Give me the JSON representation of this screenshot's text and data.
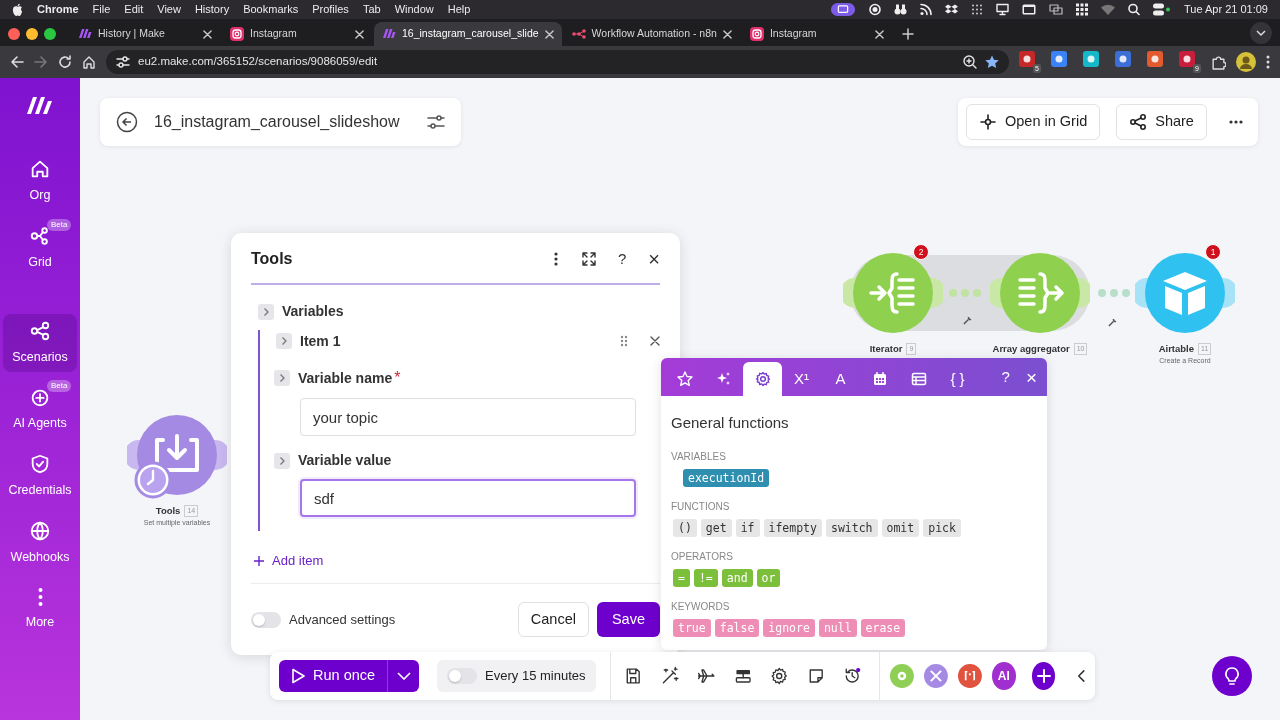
{
  "menubar": {
    "app": "Chrome",
    "items": [
      "File",
      "Edit",
      "View",
      "History",
      "Bookmarks",
      "Profiles",
      "Tab",
      "Window",
      "Help"
    ],
    "clock": "Tue Apr 21 01:09"
  },
  "tabs": [
    {
      "title": "History | Make",
      "selected": false
    },
    {
      "title": "Instagram",
      "selected": false
    },
    {
      "title": "16_instagram_carousel_slide",
      "selected": true
    },
    {
      "title": "Workflow Automation - n8n",
      "selected": false
    },
    {
      "title": "Instagram",
      "selected": false
    }
  ],
  "address": "eu2.make.com/365152/scenarios/9086059/edit",
  "extensions": [
    {
      "kind": "badged",
      "count": "5"
    },
    {
      "kind": "plain"
    },
    {
      "kind": "plain"
    },
    {
      "kind": "plain"
    },
    {
      "kind": "plain"
    },
    {
      "kind": "badged",
      "count": "9"
    }
  ],
  "sidebar": {
    "items": [
      {
        "label": "Org",
        "selected": false
      },
      {
        "label": "Grid",
        "badge": "Beta",
        "selected": false
      },
      {
        "label": "Scenarios",
        "selected": true
      },
      {
        "label": "AI Agents",
        "badge": "Beta",
        "selected": false
      },
      {
        "label": "Credentials",
        "selected": false
      },
      {
        "label": "Webhooks",
        "selected": false
      },
      {
        "label": "More",
        "selected": false
      }
    ]
  },
  "scenario": {
    "name": "16_instagram_carousel_slideshow",
    "actions": [
      "Open in Grid",
      "Share"
    ]
  },
  "nodes": [
    {
      "kind": "tools",
      "name": "Tools",
      "number": "14",
      "subtitle": "Set multiple variables"
    },
    {
      "kind": "iterator",
      "name": "Iterator",
      "number": "9",
      "badge": "2"
    },
    {
      "kind": "aggregator",
      "name": "Array aggregator",
      "number": "10"
    },
    {
      "kind": "airtable",
      "name": "Airtable",
      "number": "11",
      "subtitle": "Create a Record",
      "badge": "1"
    }
  ],
  "dialog": {
    "title": "Tools",
    "help": "?",
    "close": "×",
    "section": "Variables",
    "item": "Item 1",
    "required_mark": "*",
    "fields": [
      {
        "label": "Variable name",
        "required": true,
        "value": "your topic",
        "focused": false
      },
      {
        "label": "Variable value",
        "required": false,
        "value": "sdf",
        "focused": true
      }
    ],
    "add_item": "Add item",
    "advanced": {
      "label": "Advanced settings",
      "on": false
    },
    "cancel": "Cancel",
    "save": "Save"
  },
  "functions": {
    "tabs": [
      {
        "kind": "icon",
        "selected": false
      },
      {
        "kind": "icon",
        "selected": false
      },
      {
        "kind": "icon",
        "selected": true
      },
      {
        "kind": "text",
        "text": "X¹",
        "selected": false
      },
      {
        "kind": "text",
        "text": "A",
        "selected": false
      },
      {
        "kind": "icon",
        "selected": false
      },
      {
        "kind": "icon",
        "selected": false
      },
      {
        "kind": "text",
        "text": "{ }",
        "selected": false
      }
    ],
    "help": "?",
    "close": "×",
    "title": "General functions",
    "groups": [
      {
        "heading": "VARIABLES",
        "color": "#2f8fb0",
        "tags": [
          "executionId"
        ]
      },
      {
        "heading": "FUNCTIONS",
        "color": "#e6e6e6",
        "tags": [
          "()",
          "get",
          "if",
          "ifempty",
          "switch",
          "omit",
          "pick"
        ]
      },
      {
        "heading": "OPERATORS",
        "color": "#7cbf3a",
        "tags": [
          "=",
          "!=",
          "and",
          "or"
        ]
      },
      {
        "heading": "KEYWORDS",
        "color": "#ee8db5",
        "tags": [
          "true",
          "false",
          "ignore",
          "null",
          "erase"
        ]
      }
    ]
  },
  "toolbar": {
    "run": "Run once",
    "schedule": {
      "label": "Every 15 minutes",
      "on": false
    },
    "ai": "AI"
  }
}
